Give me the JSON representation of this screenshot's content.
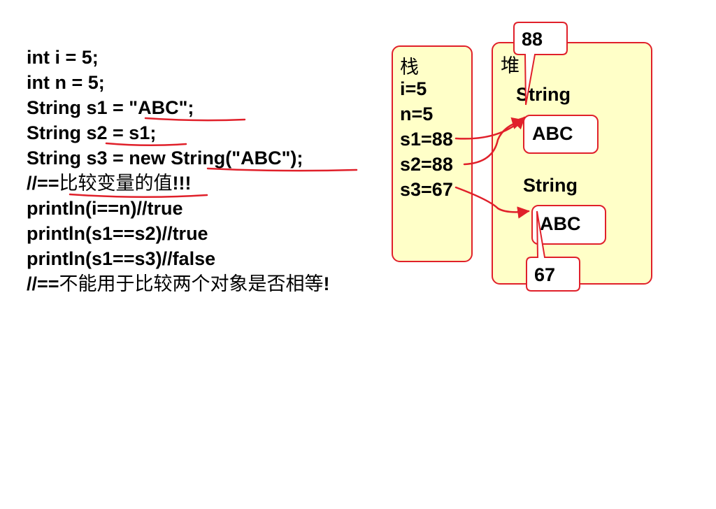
{
  "code_lines": [
    {
      "text": "int i = 5;"
    },
    {
      "text": "int n = 5;"
    },
    {
      "text": "String s1 = \"ABC\";"
    },
    {
      "text": "String s2 = s1;"
    },
    {
      "text": "String s3 = new String(\"ABC\");"
    },
    {
      "prefix": "//==",
      "cjk": "比较变量的值",
      "suffix": "!!!"
    },
    {
      "text": "println(i==n)//true"
    },
    {
      "text": "println(s1==s2)//true"
    },
    {
      "text": "println(s1==s3)//false"
    },
    {
      "prefix": "//==",
      "cjk": "不能用于比较两个对象是否相等",
      "suffix": "!"
    }
  ],
  "stack": {
    "title": "栈",
    "vars": [
      "i=5",
      "n=5",
      "s1=88",
      "s2=88",
      "s3=67"
    ]
  },
  "heap": {
    "title": "堆",
    "objects": [
      {
        "type": "String",
        "value": "ABC",
        "address": "88"
      },
      {
        "type": "String",
        "value": "ABC",
        "address": "67"
      }
    ]
  },
  "colors": {
    "accent": "#e0202a",
    "box_fill": "#ffffc8"
  }
}
